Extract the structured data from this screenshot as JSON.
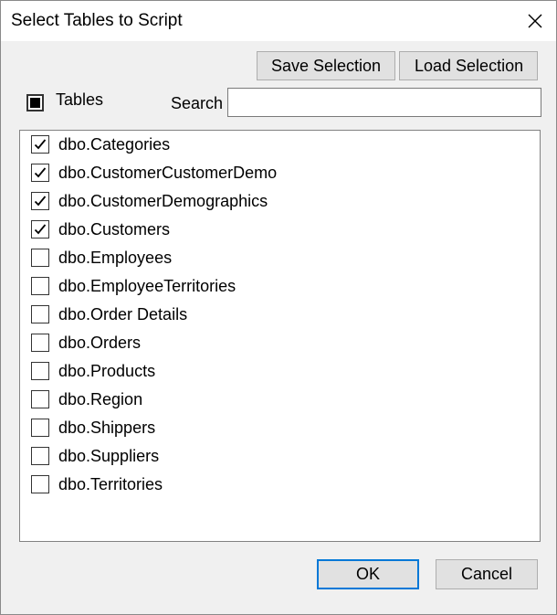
{
  "window": {
    "title": "Select Tables to Script"
  },
  "toolbar": {
    "save_label": "Save Selection",
    "load_label": "Load Selection"
  },
  "tables_toggle": {
    "label": "Tables",
    "state": "indeterminate"
  },
  "search": {
    "label": "Search",
    "value": "",
    "placeholder": ""
  },
  "tables": [
    {
      "label": "dbo.Categories",
      "checked": true
    },
    {
      "label": "dbo.CustomerCustomerDemo",
      "checked": true
    },
    {
      "label": "dbo.CustomerDemographics",
      "checked": true
    },
    {
      "label": "dbo.Customers",
      "checked": true
    },
    {
      "label": "dbo.Employees",
      "checked": false
    },
    {
      "label": "dbo.EmployeeTerritories",
      "checked": false
    },
    {
      "label": "dbo.Order Details",
      "checked": false
    },
    {
      "label": "dbo.Orders",
      "checked": false
    },
    {
      "label": "dbo.Products",
      "checked": false
    },
    {
      "label": "dbo.Region",
      "checked": false
    },
    {
      "label": "dbo.Shippers",
      "checked": false
    },
    {
      "label": "dbo.Suppliers",
      "checked": false
    },
    {
      "label": "dbo.Territories",
      "checked": false
    }
  ],
  "footer": {
    "ok_label": "OK",
    "cancel_label": "Cancel"
  },
  "colors": {
    "accent": "#0078d7",
    "button_face": "#e1e1e1",
    "dialog_background": "#f0f0f0"
  },
  "icons": {
    "close": "close-icon",
    "check": "checkmark-icon"
  }
}
